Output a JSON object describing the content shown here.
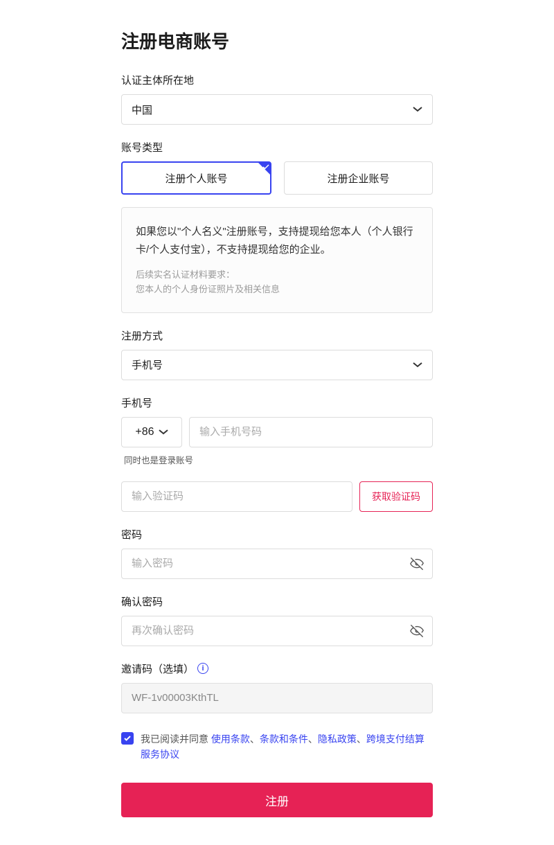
{
  "title": "注册电商账号",
  "region": {
    "label": "认证主体所在地",
    "value": "中国"
  },
  "accountType": {
    "label": "账号类型",
    "options": [
      "注册个人账号",
      "注册企业账号"
    ]
  },
  "infoBox": {
    "main": "如果您以\"个人名义\"注册账号，支持提现给您本人（个人银行卡/个人支付宝），不支持提现给您的企业。",
    "subLabel": "后续实名认证材料要求：",
    "subText": "您本人的个人身份证照片及相关信息"
  },
  "registerMethod": {
    "label": "注册方式",
    "value": "手机号"
  },
  "phone": {
    "label": "手机号",
    "prefix": "+86",
    "placeholder": "输入手机号码",
    "hint": "同时也是登录账号"
  },
  "code": {
    "placeholder": "输入验证码",
    "buttonLabel": "获取验证码"
  },
  "password": {
    "label": "密码",
    "placeholder": "输入密码"
  },
  "confirmPassword": {
    "label": "确认密码",
    "placeholder": "再次确认密码"
  },
  "inviteCode": {
    "label": "邀请码（选填）",
    "value": "WF-1v00003KthTL"
  },
  "terms": {
    "prefix": "我已阅读并同意 ",
    "links": [
      "使用条款",
      "条款和条件",
      "隐私政策",
      "跨境支付结算服务协议"
    ],
    "separator": "、"
  },
  "submit": "注册"
}
